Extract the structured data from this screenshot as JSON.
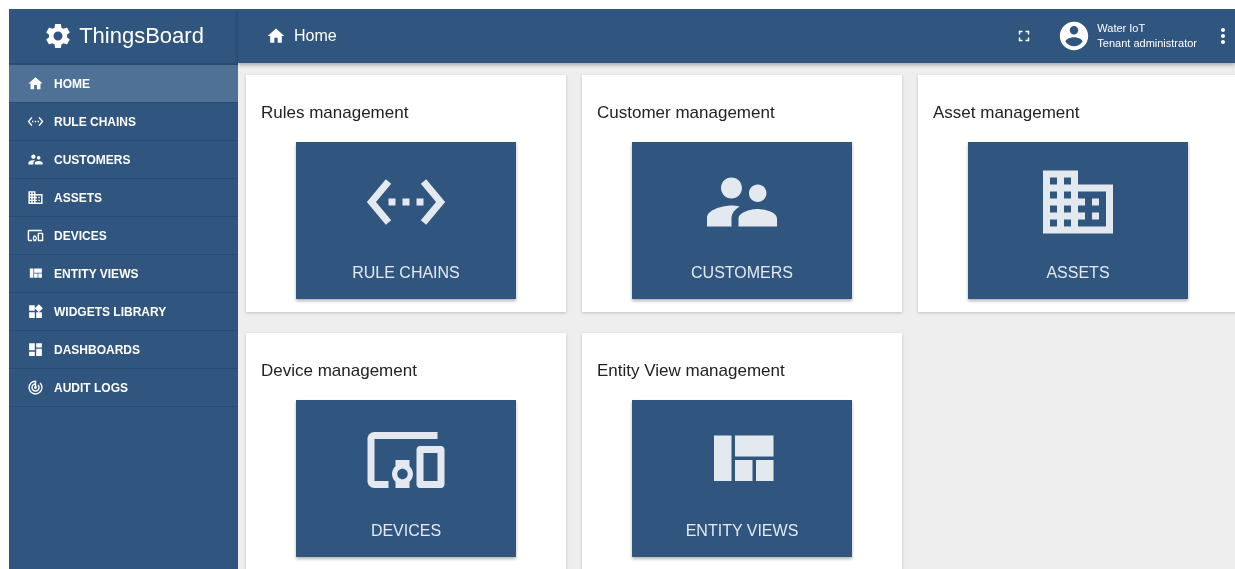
{
  "sidebar": {
    "logo_text": "ThingsBoard",
    "items": [
      {
        "label": "HOME",
        "selected": true
      },
      {
        "label": "RULE CHAINS",
        "selected": false
      },
      {
        "label": "CUSTOMERS",
        "selected": false
      },
      {
        "label": "ASSETS",
        "selected": false
      },
      {
        "label": "DEVICES",
        "selected": false
      },
      {
        "label": "ENTITY VIEWS",
        "selected": false
      },
      {
        "label": "WIDGETS LIBRARY",
        "selected": false
      },
      {
        "label": "DASHBOARDS",
        "selected": false
      },
      {
        "label": "AUDIT LOGS",
        "selected": false
      }
    ]
  },
  "header": {
    "title": "Home",
    "user_name": "Water IoT",
    "user_role": "Tenant administrator"
  },
  "cards": [
    {
      "title": "Rules management",
      "button": "RULE CHAINS"
    },
    {
      "title": "Customer management",
      "button": "CUSTOMERS"
    },
    {
      "title": "Asset management",
      "button": "ASSETS"
    },
    {
      "title": "Device management",
      "button": "DEVICES"
    },
    {
      "title": "Entity View management",
      "button": "ENTITY VIEWS"
    }
  ]
}
